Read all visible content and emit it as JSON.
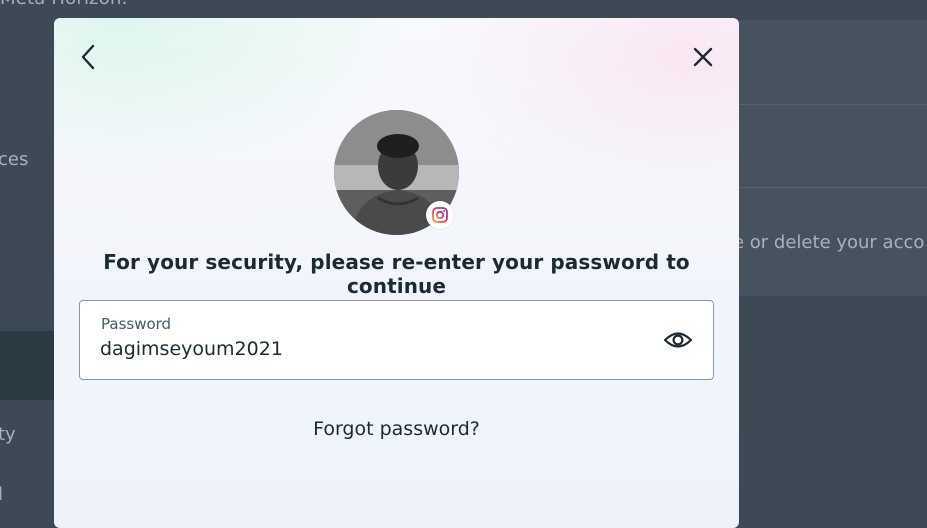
{
  "background": {
    "top_text": "Meta Horizon.",
    "left_texts": [
      "ces",
      "ty",
      "l"
    ],
    "right_text": "e or delete your acco"
  },
  "dialog": {
    "back_icon": "chevron-left-icon",
    "close_icon": "close-icon",
    "badge_icon": "instagram-icon",
    "heading": "For your security, please re-enter your password to continue",
    "password_field": {
      "label": "Password",
      "value": "dagimseyoum2021",
      "toggle_icon": "eye-icon"
    },
    "forgot_password": "Forgot password?"
  },
  "colors": {
    "text": "#1c2b33",
    "overlay": "#3d4954",
    "field_border": "#8a96a1"
  }
}
